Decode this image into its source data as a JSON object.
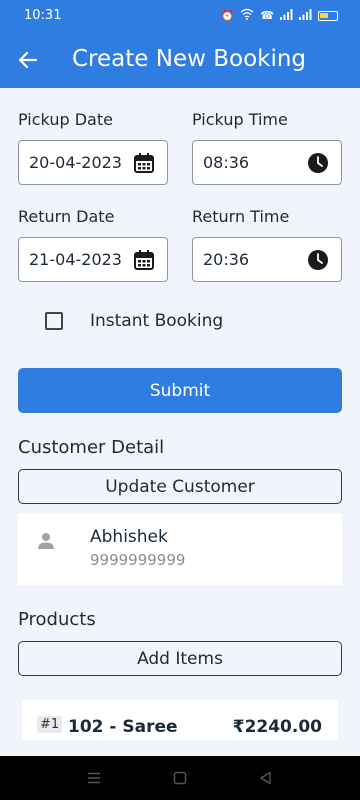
{
  "status_bar": {
    "time": "10:31",
    "icons": [
      "alarm-icon",
      "wifi-icon",
      "call-icon",
      "signal-icon",
      "signal-icon",
      "battery-icon"
    ]
  },
  "header": {
    "title": "Create New Booking",
    "back_icon": "arrow-left-icon"
  },
  "form": {
    "pickup_date_label": "Pickup Date",
    "pickup_date_value": "20-04-2023",
    "pickup_time_label": "Pickup Time",
    "pickup_time_value": "08:36",
    "return_date_label": "Return Date",
    "return_date_value": "21-04-2023",
    "return_time_label": "Return Time",
    "return_time_value": "20:36",
    "instant_booking_label": "Instant Booking",
    "instant_booking_checked": false,
    "submit_label": "Submit"
  },
  "customer": {
    "section_title": "Customer Detail",
    "update_label": "Update Customer",
    "name": "Abhishek",
    "phone": "9999999999"
  },
  "products": {
    "section_title": "Products",
    "add_label": "Add Items",
    "items": [
      {
        "index": "#1",
        "name": "102 - Saree",
        "price": "₹2240.00"
      }
    ]
  },
  "colors": {
    "primary": "#2f7de1",
    "background": "#f1f4fb",
    "text": "#1d2a38"
  }
}
